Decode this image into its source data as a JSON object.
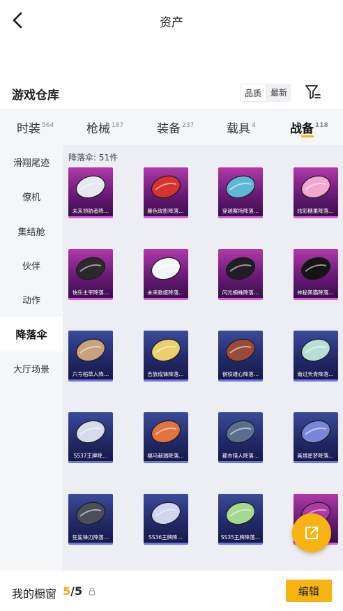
{
  "header": {
    "title": "资产"
  },
  "warehouse": {
    "title": "游戏仓库",
    "sort_options": [
      "品质",
      "最新"
    ]
  },
  "tabs": [
    {
      "label": "时装",
      "count": "564"
    },
    {
      "label": "枪械",
      "count": "187"
    },
    {
      "label": "装备",
      "count": "237"
    },
    {
      "label": "载具",
      "count": "4"
    },
    {
      "label": "战备",
      "count": "118"
    }
  ],
  "sidebar": {
    "items": [
      "滑翔尾迹",
      "僚机",
      "集结舱",
      "伙伴",
      "动作",
      "降落伞",
      "大厅场景"
    ]
  },
  "content": {
    "count_label": "降落伞: 51件",
    "items": [
      {
        "name": "未来领航者降…",
        "rarity": "purple",
        "color": "#e6e8f2"
      },
      {
        "name": "暮色玫影降落…",
        "rarity": "purple",
        "color": "#d8322e"
      },
      {
        "name": "穿越赛场降落…",
        "rarity": "purple",
        "color": "#5fb7d4"
      },
      {
        "name": "炫彩糖果降落…",
        "rarity": "purple",
        "color": "#f2a6d0"
      },
      {
        "name": "快乐主宰降落…",
        "rarity": "purple",
        "color": "#2a2a2a"
      },
      {
        "name": "未来歌姬降落…",
        "rarity": "purple",
        "color": "#f3f5fa"
      },
      {
        "name": "闪光蜘蛛降落…",
        "rarity": "purple",
        "color": "#1e1e24"
      },
      {
        "name": "神秘黑猫降落…",
        "rarity": "purple",
        "color": "#151515"
      },
      {
        "name": "六号稻草人降…",
        "rarity": "blue",
        "color": "#c7a27a"
      },
      {
        "name": "吉族成锋降落…",
        "rarity": "blue",
        "color": "#e9d06a"
      },
      {
        "name": "钢铁雄心降落…",
        "rarity": "blue",
        "color": "#9b4a3a"
      },
      {
        "name": "南过天青降落…",
        "rarity": "blue",
        "color": "#b8ded6"
      },
      {
        "name": "SS37王牌降…",
        "rarity": "blue",
        "color": "#d6dbea"
      },
      {
        "name": "福马献瑞降落…",
        "rarity": "blue",
        "color": "#e0733e"
      },
      {
        "name": "都市猎人降落…",
        "rarity": "blue",
        "color": "#5a6e8e"
      },
      {
        "name": "画境星梦降落…",
        "rarity": "blue",
        "color": "#7a86d8"
      },
      {
        "name": "狂鲨锋刃降落…",
        "rarity": "blue",
        "color": "#4a4e58"
      },
      {
        "name": "SS36王牌降…",
        "rarity": "blue",
        "color": "#cfd4f0"
      },
      {
        "name": "SS35王牌降落…",
        "rarity": "blue",
        "color": "#a6d890"
      },
      {
        "name": "",
        "rarity": "purple",
        "color": "#b03aa8"
      }
    ]
  },
  "bottom": {
    "label": "我的橱窗",
    "current": "5",
    "separator": "/5",
    "edit_label": "编辑"
  }
}
